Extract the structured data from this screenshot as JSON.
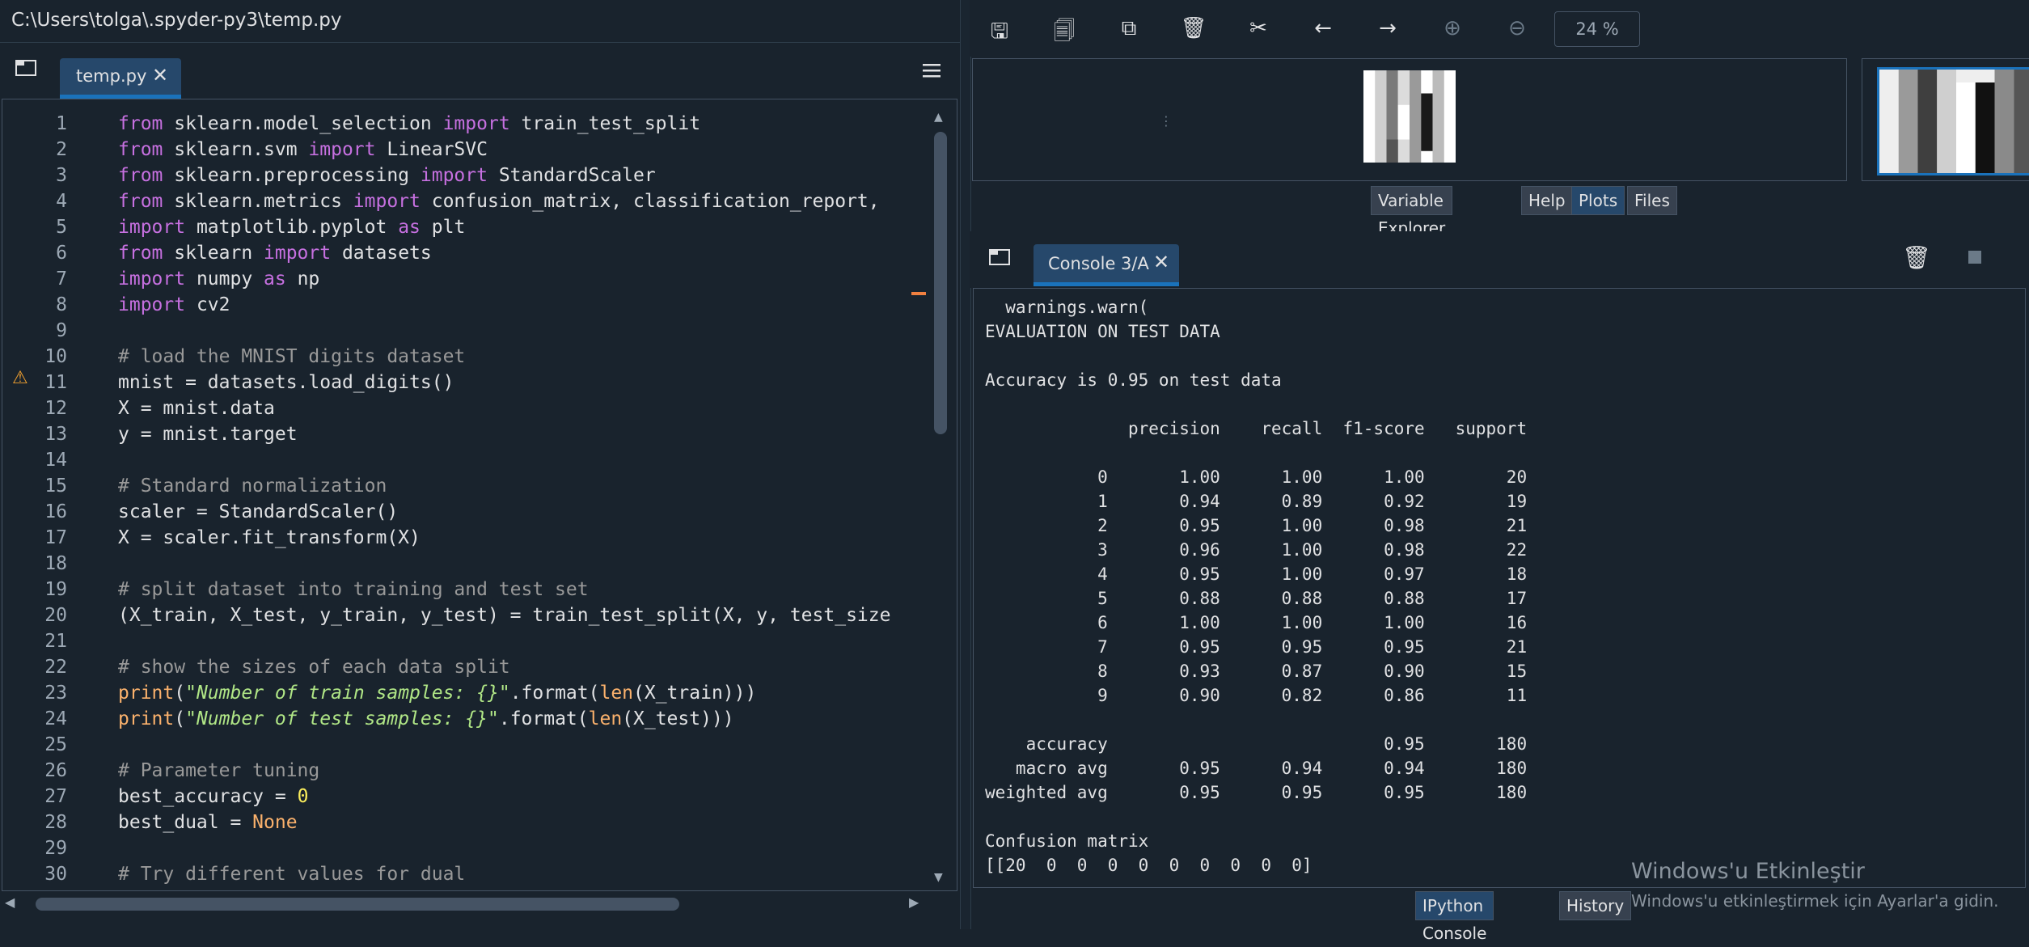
{
  "editor": {
    "path": "C:\\Users\\tolga\\.spyder-py3\\temp.py",
    "tab_label": "temp.py",
    "tab_close": "✕",
    "browse_tabs_icon": "browse-tabs-icon",
    "options_icon": "hamburger-menu-icon",
    "line_numbers": [
      "1",
      "2",
      "3",
      "4",
      "5",
      "6",
      "7",
      "8",
      "9",
      "10",
      "11",
      "12",
      "13",
      "14",
      "15",
      "16",
      "17",
      "18",
      "19",
      "20",
      "21",
      "22",
      "23",
      "24",
      "25",
      "26",
      "27",
      "28",
      "29",
      "30"
    ],
    "warning_icon": "warning-icon"
  },
  "plots": {
    "toolbar_icons": [
      "save-icon",
      "save-all-icon",
      "copy-icon",
      "delete-icon",
      "delete-all-icon",
      "previous-icon",
      "next-icon",
      "zoom-in-icon",
      "zoom-out-icon"
    ],
    "zoom": "24 %",
    "tabs": [
      "Variable Explorer",
      "Help",
      "Plots",
      "Files"
    ],
    "active_tab": "Plots"
  },
  "console": {
    "tab_label": "Console 3/A",
    "tab_close": "✕",
    "output": "  warnings.warn(\nEVALUATION ON TEST DATA\n\nAccuracy is 0.95 on test data\n\n              precision    recall  f1-score   support\n\n           0       1.00      1.00      1.00        20\n           1       0.94      0.89      0.92        19\n           2       0.95      1.00      0.98        21\n           3       0.96      1.00      0.98        22\n           4       0.95      1.00      0.97        18\n           5       0.88      0.88      0.88        17\n           6       1.00      1.00      1.00        16\n           7       0.95      0.95      0.95        21\n           8       0.93      0.87      0.90        15\n           9       0.90      0.82      0.86        11\n\n    accuracy                           0.95       180\n   macro avg       0.95      0.94      0.94       180\nweighted avg       0.95      0.95      0.95       180\n\nConfusion matrix\n[[20  0  0  0  0  0  0  0  0  0]",
    "bottom_tabs": [
      "IPython Console",
      "History"
    ],
    "active_bottom_tab": "IPython Console"
  },
  "windows_activation": {
    "title": "Windows'u Etkinleştir",
    "subtitle": "Windows'u etkinleştirmek için Ayarlar'a gidin."
  },
  "colors": {
    "background": "#19232d",
    "accent": "#1a72bb",
    "keyword": "#c670e0",
    "comment": "#999999",
    "string": "#b0e686",
    "builtin": "#fab16c",
    "number": "#faed5c"
  }
}
